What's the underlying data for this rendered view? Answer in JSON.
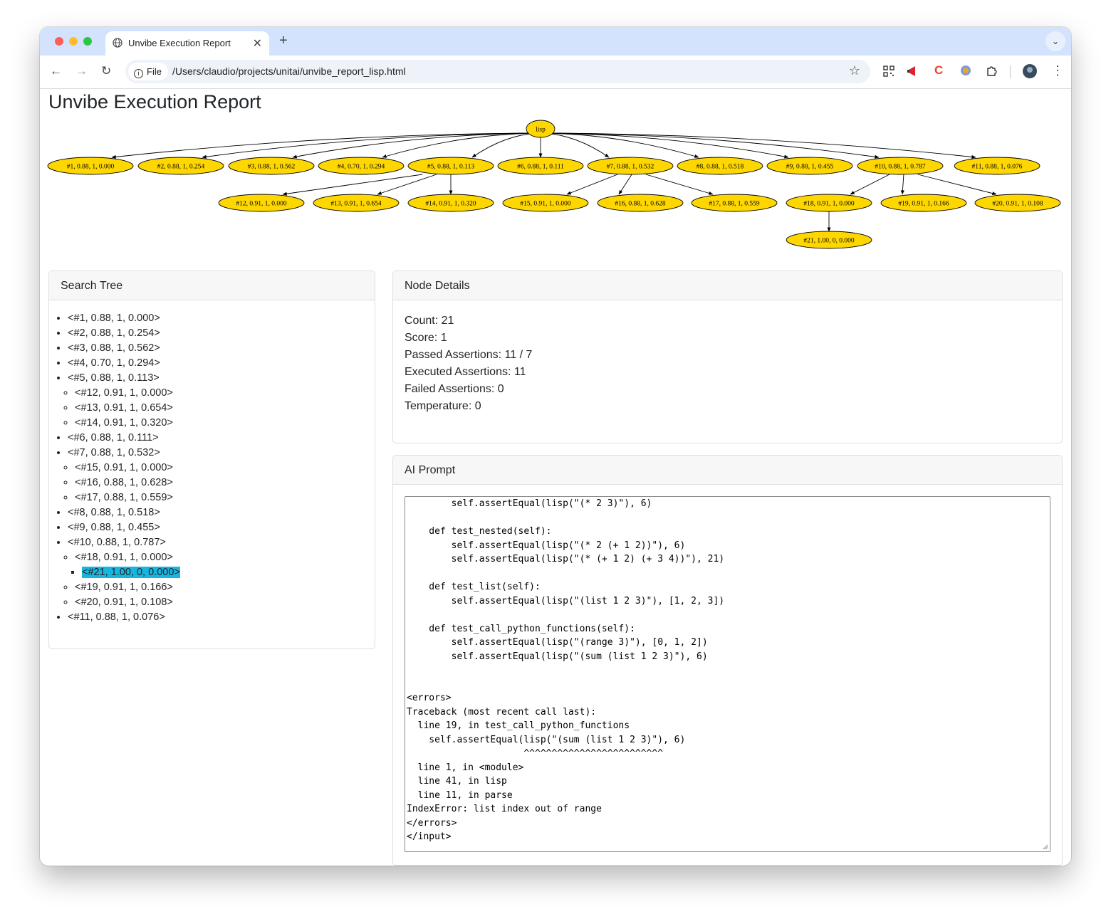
{
  "browser": {
    "tab_title": "Unvibe Execution Report",
    "tab_close": "✕",
    "new_tab": "+",
    "tab_menu": "⌄",
    "back": "←",
    "forward": "→",
    "reload": "↻",
    "scheme_label": "File",
    "url": "/Users/claudio/projects/unitai/unvibe_report_lisp.html",
    "bookmark_star": "☆",
    "menu": "⋮"
  },
  "page": {
    "title": "Unvibe Execution Report"
  },
  "graph": {
    "root": "lisp",
    "level1": [
      "#1, 0.88, 1, 0.000",
      "#2, 0.88, 1, 0.254",
      "#3, 0.88, 1, 0.562",
      "#4, 0.70, 1, 0.294",
      "#5, 0.88, 1, 0.113",
      "#6, 0.88, 1, 0.111",
      "#7, 0.88, 1, 0.532",
      "#8, 0.88, 1, 0.518",
      "#9, 0.88, 1, 0.455",
      "#10, 0.88, 1, 0.787",
      "#11, 0.88, 1, 0.076"
    ],
    "level2": [
      "#12, 0.91, 1, 0.000",
      "#13, 0.91, 1, 0.654",
      "#14, 0.91, 1, 0.320",
      "#15, 0.91, 1, 0.000",
      "#16, 0.88, 1, 0.628",
      "#17, 0.88, 1, 0.559",
      "#18, 0.91, 1, 0.000",
      "#19, 0.91, 1, 0.166",
      "#20, 0.91, 1, 0.108"
    ],
    "level3": [
      "#21, 1.00, 0, 0.000"
    ],
    "node_color": "#ffd700"
  },
  "search_tree": {
    "header": "Search Tree",
    "items": [
      {
        "label": "<#1, 0.88, 1, 0.000>"
      },
      {
        "label": "<#2, 0.88, 1, 0.254>"
      },
      {
        "label": "<#3, 0.88, 1, 0.562>"
      },
      {
        "label": "<#4, 0.70, 1, 0.294>"
      },
      {
        "label": "<#5, 0.88, 1, 0.113>",
        "children": [
          {
            "label": "<#12, 0.91, 1, 0.000>"
          },
          {
            "label": "<#13, 0.91, 1, 0.654>"
          },
          {
            "label": "<#14, 0.91, 1, 0.320>"
          }
        ]
      },
      {
        "label": "<#6, 0.88, 1, 0.111>"
      },
      {
        "label": "<#7, 0.88, 1, 0.532>",
        "children": [
          {
            "label": "<#15, 0.91, 1, 0.000>"
          },
          {
            "label": "<#16, 0.88, 1, 0.628>"
          },
          {
            "label": "<#17, 0.88, 1, 0.559>"
          }
        ]
      },
      {
        "label": "<#8, 0.88, 1, 0.518>"
      },
      {
        "label": "<#9, 0.88, 1, 0.455>"
      },
      {
        "label": "<#10, 0.88, 1, 0.787>",
        "children": [
          {
            "label": "<#18, 0.91, 1, 0.000>",
            "children": [
              {
                "label": "<#21, 1.00, 0, 0.000>",
                "selected": true
              }
            ]
          },
          {
            "label": "<#19, 0.91, 1, 0.166>"
          },
          {
            "label": "<#20, 0.91, 1, 0.108>"
          }
        ]
      },
      {
        "label": "<#11, 0.88, 1, 0.076>"
      }
    ],
    "selected_color": "#17b6e0"
  },
  "node_details": {
    "header": "Node Details",
    "count": "Count: 21",
    "score": "Score: 1",
    "passed": "Passed Assertions: 11 / 7",
    "executed": "Executed Assertions: 11",
    "failed": "Failed Assertions: 0",
    "temperature": "Temperature: 0"
  },
  "ai_prompt": {
    "header": "AI Prompt",
    "lines": [
      "        self.assertEqual(lisp(\"(* 2 3)\"), 6)",
      "",
      "    def test_nested(self):",
      "        self.assertEqual(lisp(\"(* 2 (+ 1 2))\"), 6)",
      "        self.assertEqual(lisp(\"(* (+ 1 2) (+ 3 4))\"), 21)",
      "",
      "    def test_list(self):",
      "        self.assertEqual(lisp(\"(list 1 2 3)\"), [1, 2, 3])",
      "",
      "    def test_call_python_functions(self):",
      "        self.assertEqual(lisp(\"(range 3)\"), [0, 1, 2])",
      "        self.assertEqual(lisp(\"(sum (list 1 2 3)\"), 6)",
      "",
      "",
      "<errors>",
      "Traceback (most recent call last):",
      "  line 19, in test_call_python_functions",
      "    self.assertEqual(lisp(\"(sum (list 1 2 3)\"), 6)",
      "                     ^^^^^^^^^^^^^^^^^^^^^^^^^",
      "  line 1, in <module>",
      "  line 41, in lisp",
      "  line 11, in parse",
      "IndexError: list index out of range",
      "</errors>",
      "</input>"
    ]
  }
}
